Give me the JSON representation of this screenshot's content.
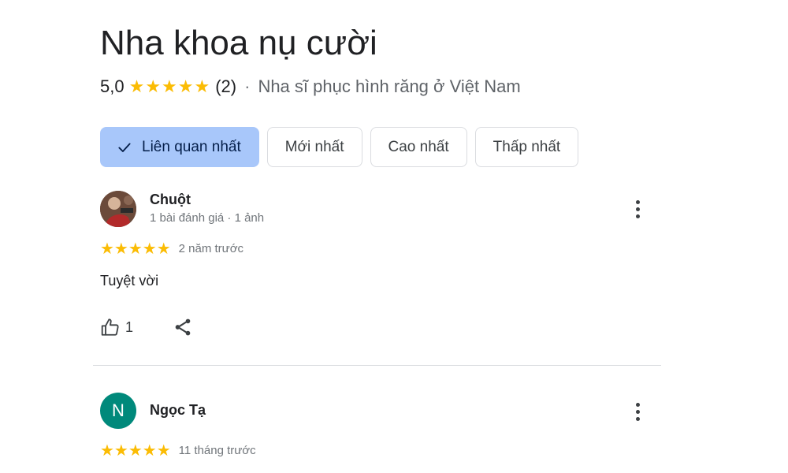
{
  "place": {
    "name": "Nha khoa nụ cười",
    "rating": "5,0",
    "stars": "★★★★★",
    "review_count": "(2)",
    "separator": "·",
    "category": "Nha sĩ phục hình răng ở Việt Nam"
  },
  "sort_chips": [
    {
      "label": "Liên quan nhất",
      "selected": true
    },
    {
      "label": "Mới nhất",
      "selected": false
    },
    {
      "label": "Cao nhất",
      "selected": false
    },
    {
      "label": "Thấp nhất",
      "selected": false
    }
  ],
  "reviews": [
    {
      "author": "Chuột",
      "meta": "1 bài đánh giá · 1 ảnh",
      "avatar": "photo",
      "stars": "★★★★★",
      "rating": 5,
      "time": "2 năm trước",
      "text": "Tuyệt vời",
      "likes": "1"
    },
    {
      "author": "Ngọc Tạ",
      "avatar_letter": "N",
      "avatar_color": "#00897b",
      "stars": "★★★★★",
      "rating": 5,
      "time": "11 tháng trước"
    }
  ],
  "colors": {
    "star": "#fbbc04",
    "selected_chip": "#a8c7fa"
  },
  "icons": {
    "check": "check-icon",
    "more": "more-vert-icon",
    "like": "thumb-up-icon",
    "share": "share-icon"
  }
}
